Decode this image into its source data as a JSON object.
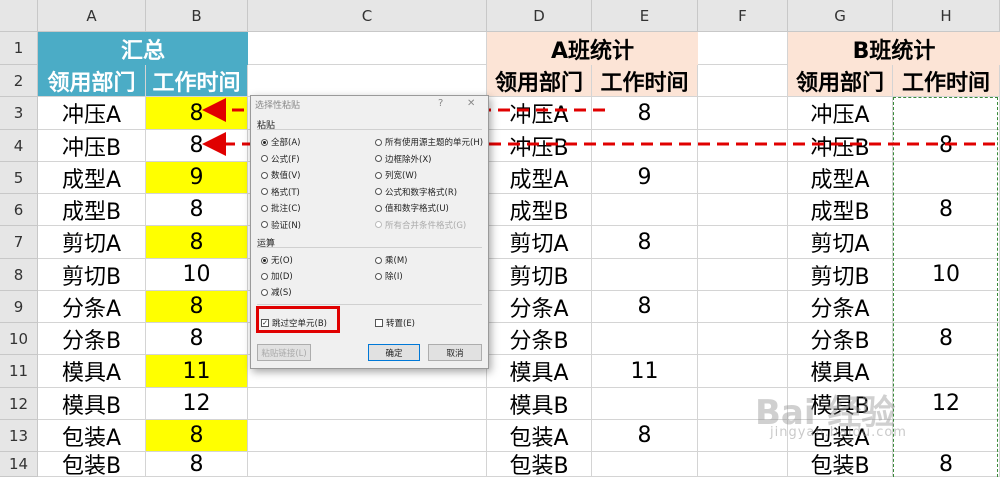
{
  "columns": [
    "A",
    "B",
    "C",
    "D",
    "E",
    "F",
    "G",
    "H"
  ],
  "rows": [
    "1",
    "2",
    "3",
    "4",
    "5",
    "6",
    "7",
    "8",
    "9",
    "10",
    "11",
    "12",
    "13",
    "14"
  ],
  "summary": {
    "title": "汇总",
    "header_dept": "领用部门",
    "header_time": "工作时间",
    "depts": [
      "冲压A",
      "冲压B",
      "成型A",
      "成型B",
      "剪切A",
      "剪切B",
      "分条A",
      "分条B",
      "模具A",
      "模具B",
      "包装A",
      "包装B"
    ],
    "times": [
      "8",
      "8",
      "9",
      "8",
      "8",
      "10",
      "8",
      "8",
      "11",
      "12",
      "8",
      "8"
    ]
  },
  "a_team": {
    "title": "A班统计",
    "header_dept": "领用部门",
    "header_time": "工作时间",
    "depts": [
      "冲压A",
      "冲压B",
      "成型A",
      "成型B",
      "剪切A",
      "剪切B",
      "分条A",
      "分条B",
      "模具A",
      "模具B",
      "包装A",
      "包装B"
    ],
    "times": [
      "8",
      "",
      "9",
      "",
      "8",
      "",
      "8",
      "",
      "11",
      "",
      "8",
      ""
    ]
  },
  "b_team": {
    "title": "B班统计",
    "header_dept": "领用部门",
    "header_time": "工作时间",
    "depts": [
      "冲压A",
      "冲压B",
      "成型A",
      "成型B",
      "剪切A",
      "剪切B",
      "分条A",
      "分条B",
      "模具A",
      "模具B",
      "包装A",
      "包装B"
    ],
    "times": [
      "",
      "8",
      "",
      "8",
      "",
      "10",
      "",
      "8",
      "",
      "12",
      "",
      "8"
    ]
  },
  "dialog": {
    "title": "选择性粘贴",
    "help": "?",
    "close": "✕",
    "paste_group": "粘贴",
    "paste_left": [
      "全部(A)",
      "公式(F)",
      "数值(V)",
      "格式(T)",
      "批注(C)",
      "验证(N)"
    ],
    "paste_right": [
      "所有使用源主题的单元(H)",
      "边框除外(X)",
      "列宽(W)",
      "公式和数字格式(R)",
      "值和数字格式(U)",
      "所有合并条件格式(G)"
    ],
    "op_group": "运算",
    "op_left": [
      "无(O)",
      "加(D)",
      "减(S)"
    ],
    "op_right": [
      "乘(M)",
      "除(I)"
    ],
    "skip_blanks": "跳过空单元(B)",
    "transpose": "转置(E)",
    "paste_link": "粘贴链接(L)",
    "ok": "确定",
    "cancel": "取消"
  },
  "watermark": {
    "logo": "Bai 经验",
    "url": "jingyan.baidu.com"
  },
  "colors": {
    "teal": "#4bacc6",
    "peach": "#fce4d6",
    "yellow": "#ffff00",
    "arrow_red": "#e00000",
    "dash_green": "#3a8a3a"
  }
}
